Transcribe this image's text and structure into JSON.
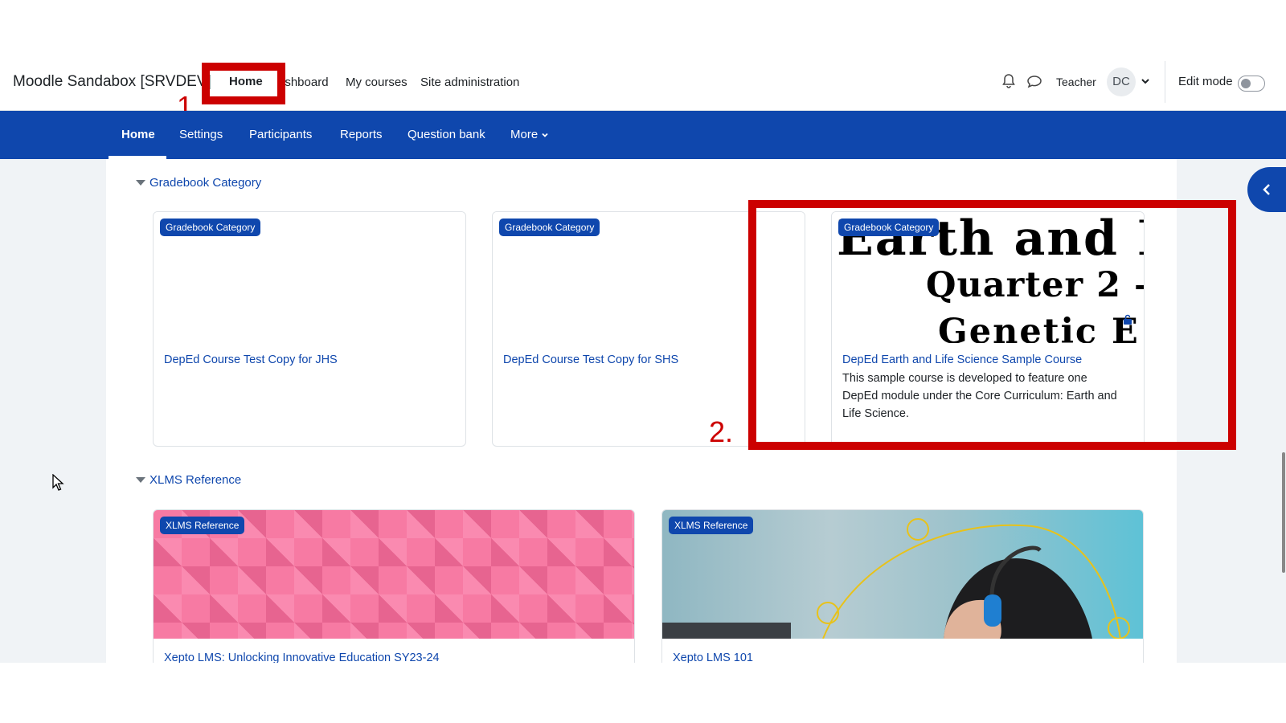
{
  "site": {
    "name": "Moodle Sandabox [SRVDEV]"
  },
  "primary_nav": {
    "items": [
      "Home",
      "ashboard",
      "My courses",
      "Site administration"
    ]
  },
  "header_right": {
    "user_role": "Teacher",
    "avatar_initials": "DC",
    "edit_mode_label": "Edit mode",
    "edit_mode_on": false,
    "icons": [
      "bell-icon",
      "chat-icon",
      "chevron-down-icon"
    ]
  },
  "secondary_nav": {
    "items": [
      "Home",
      "Settings",
      "Participants",
      "Reports",
      "Question bank",
      "More"
    ]
  },
  "annotations": {
    "box1_number": "1.",
    "box2_number": "2."
  },
  "sections": [
    {
      "heading": "Gradebook Category",
      "courses": [
        {
          "badge": "Gradebook Category",
          "title": "DepEd Course Test Copy for JHS",
          "summary": ""
        },
        {
          "badge": "Gradebook Category",
          "title": "DepEd Course Test Copy for SHS",
          "summary": ""
        },
        {
          "badge": "Gradebook Category",
          "title": "DepEd Earth and Life Science Sample Course",
          "summary": "This sample course is developed to feature one DepEd module under the Core Curriculum: Earth and Life Science.",
          "image_text": [
            "Earth and L",
            "Quarter 2 –",
            "Genetic E"
          ]
        }
      ]
    },
    {
      "heading": "XLMS Reference",
      "courses": [
        {
          "badge": "XLMS Reference",
          "title": "Xepto LMS: Unlocking Innovative Education SY23-24"
        },
        {
          "badge": "XLMS Reference",
          "title": "Xepto LMS 101"
        }
      ]
    }
  ],
  "colors": {
    "brand": "#0f47ad",
    "highlight": "#cc0000",
    "link": "#0f47ad"
  }
}
